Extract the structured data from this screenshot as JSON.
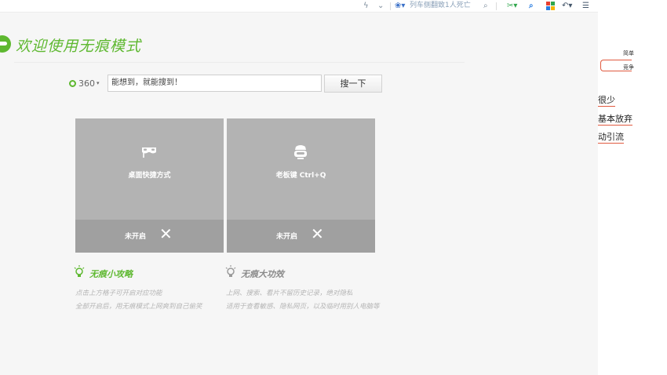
{
  "toolbar": {
    "news_text": "列车侧翻致1人死亡",
    "search_glyph": "⌕",
    "lightning_glyph": "ϟ",
    "chevron_glyph": "⌄",
    "scissor_glyph": "✂▾",
    "find_glyph": "⌕",
    "undo_glyph": "↶▾",
    "menu_glyph": "☰"
  },
  "header": {
    "title": "欢迎使用无痕模式"
  },
  "search": {
    "engine_label": "360",
    "engine_caret": "▾",
    "placeholder": "能想到，就能搜到！",
    "button_label": "搜一下"
  },
  "tiles": [
    {
      "label": "桌面快捷方式",
      "status": "未开启",
      "close": "✕"
    },
    {
      "label": "老板键 Ctrl+Q",
      "status": "未开启",
      "close": "✕"
    }
  ],
  "tips": {
    "title": "无痕小攻略",
    "lines": [
      "点击上方格子可开启对应功能",
      "全部开启后，用无痕模式上网爽到自己偷笑"
    ]
  },
  "effects": {
    "title": "无痕大功效",
    "lines": [
      "上网、搜索、看片不留历史记录，绝对隐私",
      "适用于查看敏感、隐私网页，以及临时用别人电脑等"
    ]
  },
  "side_notes": {
    "simple": "简单",
    "compete": "竞争",
    "items": [
      "很少",
      "基本放弃",
      "动引流"
    ]
  },
  "colors": {
    "brand_green": "#5eb830",
    "tile_gray": "#b3b3b3",
    "tile_bar": "#a0a0a0",
    "note_red": "#e05a3f"
  }
}
